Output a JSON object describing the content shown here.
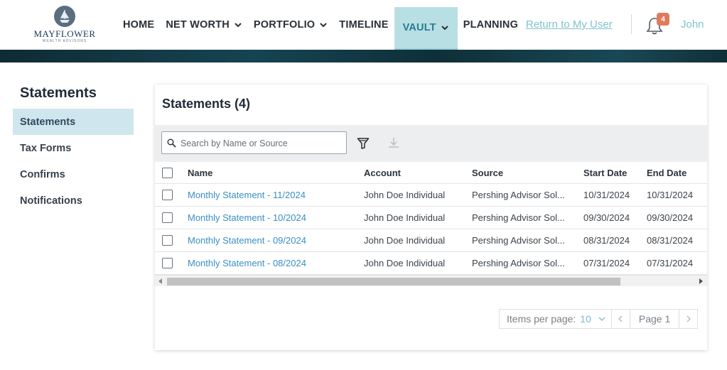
{
  "brand": {
    "logo_text": "MAYFLOWER",
    "logo_sub": "WEALTH ADVISORS"
  },
  "nav": {
    "items": [
      {
        "label": "HOME",
        "dropdown": false
      },
      {
        "label": "NET WORTH",
        "dropdown": true
      },
      {
        "label": "PORTFOLIO",
        "dropdown": true
      },
      {
        "label": "TIMELINE",
        "dropdown": false
      },
      {
        "label": "VAULT",
        "dropdown": true,
        "active": true
      },
      {
        "label": "PLANNING",
        "dropdown": false
      }
    ],
    "return_link": "Return to My User",
    "notification_count": "4",
    "user_name": "John"
  },
  "sidebar": {
    "title": "Statements",
    "items": [
      {
        "label": "Statements",
        "active": true
      },
      {
        "label": "Tax Forms"
      },
      {
        "label": "Confirms"
      },
      {
        "label": "Notifications"
      }
    ]
  },
  "main": {
    "title": "Statements (4)",
    "search_placeholder": "Search by Name or Source",
    "columns": [
      "Name",
      "Account",
      "Source",
      "Start Date",
      "End Date"
    ],
    "rows": [
      {
        "name": "Monthly Statement - 11/2024",
        "account": "John Doe Individual",
        "source": "Pershing Advisor Sol...",
        "start": "10/31/2024",
        "end": "10/31/2024"
      },
      {
        "name": "Monthly Statement - 10/2024",
        "account": "John Doe Individual",
        "source": "Pershing Advisor Sol...",
        "start": "09/30/2024",
        "end": "09/30/2024"
      },
      {
        "name": "Monthly Statement - 09/2024",
        "account": "John Doe Individual",
        "source": "Pershing Advisor Sol...",
        "start": "08/31/2024",
        "end": "08/31/2024"
      },
      {
        "name": "Monthly Statement - 08/2024",
        "account": "John Doe Individual",
        "source": "Pershing Advisor Sol...",
        "start": "07/31/2024",
        "end": "07/31/2024"
      }
    ],
    "pager": {
      "items_per_page_label": "Items per page:",
      "items_per_page_value": "10",
      "page_label": "Page 1"
    }
  },
  "colors": {
    "accent": "#7fc3cf",
    "active_nav_bg": "#b8dfe4",
    "link": "#3a8fc2",
    "badge": "#e07a5f",
    "sidebar_active": "#cfe6ee"
  }
}
